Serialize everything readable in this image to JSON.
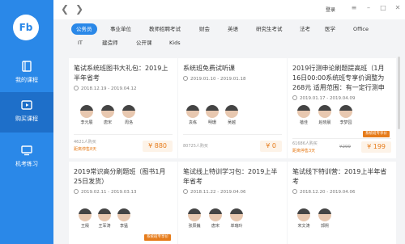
{
  "app": {
    "logo_text": "Fb"
  },
  "sidebar": {
    "items": [
      {
        "label": "我的课程",
        "icon": "book-icon"
      },
      {
        "label": "购买课程",
        "icon": "play-icon"
      },
      {
        "label": "机考练习",
        "icon": "computer-icon"
      }
    ],
    "active_index": 1
  },
  "topbar": {
    "login_label": "登录"
  },
  "categories": {
    "row1": [
      "公务员",
      "事业单位",
      "教师招聘考试",
      "财会",
      "英语",
      "研究生考试",
      "法考",
      "医学",
      "Office"
    ],
    "row2": [
      "IT",
      "建造师",
      "公开课",
      "Kids"
    ],
    "active": "公务员"
  },
  "cards": [
    {
      "title": "笔试系统班图书大礼包：2019上半年省考",
      "date": "2018.12.19 - 2019.04.12",
      "teachers": [
        "李元展",
        "唐宋",
        "周洛"
      ],
      "buyers": "4621人购买",
      "remain": "距离停售8天",
      "price": "¥ 880"
    },
    {
      "title": "系统班免费试听课",
      "date": "2019.01.10 - 2019.01.18",
      "teachers": [
        "袁栋",
        "明珊",
        "吴越"
      ],
      "buyers": "80725人购买",
      "price": "¥ 0"
    },
    {
      "title": "2019行测申论刷题提高班（1月16日00:00系统班专享价调整为268元 适用范围：有一定行测申",
      "date": "2019.01.17 - 2019.04.09",
      "teachers": [
        "蓓佳",
        "赵晓晨",
        "李梦园"
      ],
      "buyers": "61686人购买",
      "remain": "距离停售3天",
      "badge": "系统班专享价",
      "old_price": "¥299",
      "price": "¥ 199"
    },
    {
      "title": "2019常识高分刷题班（图书1月25日发货）",
      "date": "2019.02.11 - 2019.03.13",
      "teachers": [
        "王殿",
        "王军涛",
        "李猛"
      ],
      "badge": "系统班专享价"
    },
    {
      "title": "笔试线上特训学习包：2019上半年省考",
      "date": "2018.11.22 - 2019.04.06",
      "teachers": [
        "张辰巍",
        "唐宋",
        "单瑞玲"
      ]
    },
    {
      "title": "笔试线下特训营：2019上半年省考",
      "date": "2018.12.20 - 2019.04.06",
      "teachers": [
        "宋文涛",
        "郭熙"
      ]
    }
  ],
  "colors": {
    "brand": "#2a88e8",
    "accent": "#e67c1b"
  }
}
